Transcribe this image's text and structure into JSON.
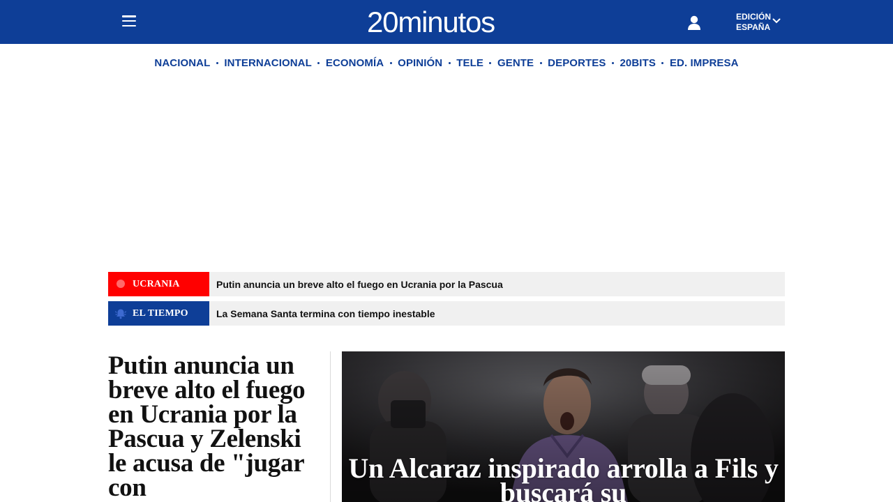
{
  "header": {
    "logo": "20minutos",
    "edition_line1": "EDICIÓN",
    "edition_line2": "ESPAÑA",
    "menu_icon": "hamburger-menu-icon",
    "user_icon": "user-icon",
    "brand_color": "#0e3e97"
  },
  "nav": {
    "items": [
      "NACIONAL",
      "INTERNACIONAL",
      "ECONOMÍA",
      "OPINIÓN",
      "TELE",
      "GENTE",
      "DEPORTES",
      "20BITS",
      "ED. IMPRESA"
    ]
  },
  "tickers": [
    {
      "tag": "UCRANIA",
      "headline": "Putin anuncia un breve alto el fuego en Ucrania por la Pascua",
      "color": "#ff0000",
      "icon": "live-dot-icon"
    },
    {
      "tag": "EL TIEMPO",
      "headline": "La Semana Santa termina con tiempo inestable",
      "color": "#0e3e97",
      "icon": "bell-icon"
    }
  ],
  "lead": {
    "title": "Putin anuncia un breve alto el fuego en Ucrania por la Pascua y Zelenski le acusa de \"jugar con"
  },
  "hero": {
    "title": "Un Alcaraz inspirado arrolla a Fils y buscará su"
  }
}
